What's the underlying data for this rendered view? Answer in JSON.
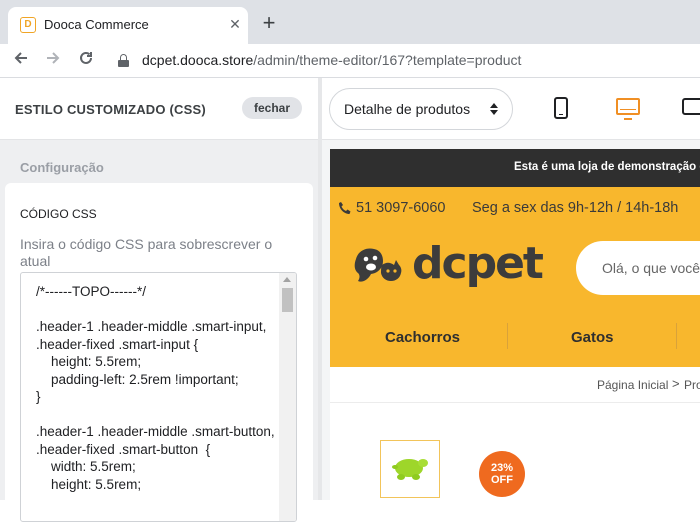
{
  "browser": {
    "tab_title": "Dooca Commerce",
    "tab_favicon": "D",
    "close_tab": "✕",
    "new_tab": "+",
    "url_domain": "dcpet.dooca.store",
    "url_path": "/admin/theme-editor/167?template=product",
    "icons": [
      "back-arrow-icon",
      "forward-arrow-icon",
      "reload-icon",
      "lock-icon"
    ]
  },
  "editor": {
    "panel_title": "ESTILO CUSTOMIZADO (CSS)",
    "close_label": "fechar",
    "section_label": "Configuração",
    "css_title": "CÓDIGO CSS",
    "css_help": "Insira o código CSS para sobrescrever o atual",
    "css_code": "/*------TOPO------*/\n\n.header-1 .header-middle .smart-input, .header-fixed .smart-input {\n    height: 5.5rem;\n    padding-left: 2.5rem !important;\n}\n\n.header-1 .header-middle .smart-button, .header-fixed .smart-button  {\n    width: 5.5rem;\n    height: 5.5rem;"
  },
  "preview_toolbar": {
    "template_select": "Detalhe de produtos",
    "devices": [
      "mobile-icon",
      "desktop-icon",
      "tablet-icon"
    ],
    "active_device": "desktop",
    "accent_color": "#f08f24"
  },
  "store": {
    "promo": "Esta é uma loja de demonstração d",
    "phone": "51 3097-6060",
    "hours": "Seg a sex das 9h-12h / 14h-18h",
    "logo": "dcpet",
    "search_placeholder": "Olá, o que você",
    "nav": [
      "Cachorros",
      "Gatos"
    ],
    "breadcrumb_home": "Página Inicial",
    "breadcrumb_sep": ">",
    "breadcrumb_next": "Pro",
    "discount": "23%\nOFF",
    "header_color": "#f8b72d",
    "promo_color": "#2f2f2f",
    "discount_color": "#ef6a1f"
  }
}
